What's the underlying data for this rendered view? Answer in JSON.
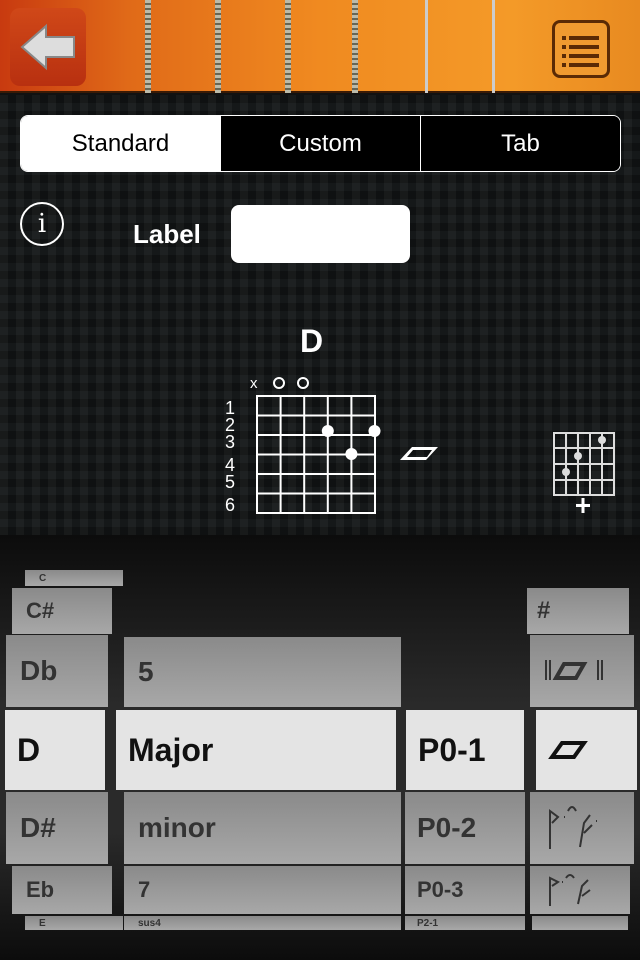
{
  "header": {
    "back_icon": "back-arrow-icon",
    "menu_icon": "list-menu-icon"
  },
  "tabs": [
    {
      "label": "Standard",
      "selected": true
    },
    {
      "label": "Custom"
    },
    {
      "label": "Tab"
    }
  ],
  "label_field": {
    "label": "Label",
    "value": ""
  },
  "chord": {
    "name": "D",
    "string_markers": [
      "x",
      "o",
      "o"
    ],
    "fret_numbers": [
      "1",
      "2",
      "3",
      "4",
      "5",
      "6"
    ],
    "strum_icon": "strum-symbol-icon",
    "add_icon": "add-chord-diagram-icon"
  },
  "picker": {
    "roots": [
      "C",
      "C#",
      "Db",
      "D",
      "D#",
      "Eb",
      "E"
    ],
    "types": [
      "5",
      "Major",
      "minor",
      "7",
      "sus4"
    ],
    "positions": [
      "P0-1",
      "P0-2",
      "P0-3",
      "P2-1"
    ],
    "symbols": [
      "#",
      "repeat-strum-icon",
      "strum-icon",
      "ornament-icon",
      "ornament-icon",
      "ornament-icon"
    ],
    "selected": {
      "root": "D",
      "type": "Major",
      "position": "P0-1"
    }
  }
}
